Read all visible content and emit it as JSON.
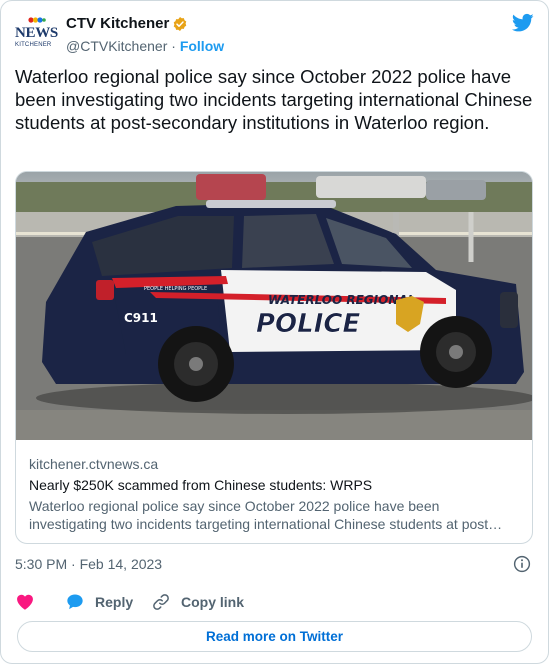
{
  "author": {
    "display_name": "CTV Kitchener",
    "handle": "@CTVKitchener",
    "separator": "·",
    "follow_label": "Follow",
    "avatar_text": "NEWS",
    "avatar_subtext": "KITCHENER",
    "verified_icon": "verified-badge-icon",
    "verified_color": "#e8a317"
  },
  "platform_icon": "twitter-bird-icon",
  "brand_color": "#1d9bf0",
  "tweet": {
    "text": "Waterloo regional police say since October 2022 police have been investigating two incidents targeting international Chinese students at post-secondary institutions in Waterloo region."
  },
  "link_card": {
    "domain": "kitchener.ctvnews.ca",
    "title": "Nearly $250K scammed from Chinese students: WRPS",
    "description": "Waterloo regional police say since October 2022 police have been investigating two incidents targeting international Chinese students at post…",
    "image_text": {
      "unit": "C911",
      "agency_line1": "WATERLOO REGIONAL",
      "agency_line2": "POLICE",
      "stripe": "PEOPLE HELPING PEOPLE"
    }
  },
  "timestamp": "5:30 PM · Feb 14, 2023",
  "actions": {
    "like_icon": "heart-icon",
    "like_color": "#f91880",
    "reply_label": "Reply",
    "reply_icon": "speech-bubble-icon",
    "copy_label": "Copy link",
    "copy_icon": "link-icon",
    "info_icon": "info-icon"
  },
  "read_more_label": "Read more on Twitter"
}
